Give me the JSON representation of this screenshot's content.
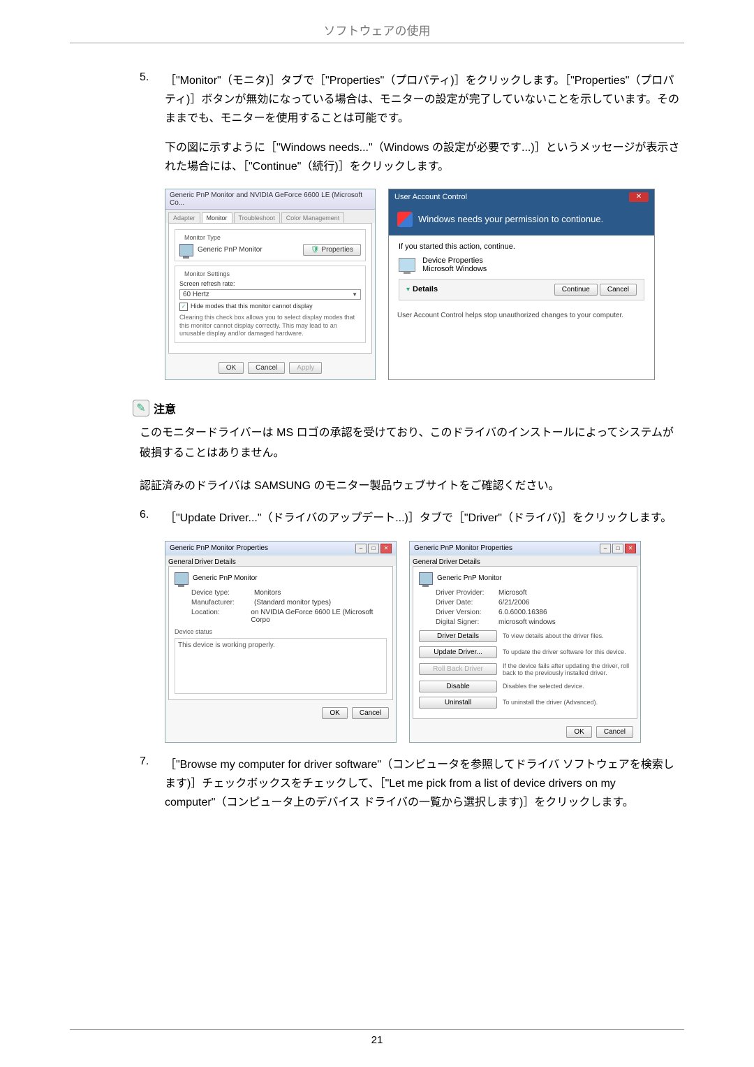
{
  "page": {
    "header_title": "ソフトウェアの使用",
    "footer_page": "21"
  },
  "step5": {
    "num": "5.",
    "body_html": "［\"Monitor\"（モニタ)］タブで［\"Properties\"（プロパティ)］をクリックします。［\"Properties\"（プロパティ)］ボタンが無効になっている場合は、モニターの設定が完了していないことを示しています。そのままでも、モニターを使用することは可能です。",
    "para2": "下の図に示すように［\"Windows needs...\"（Windows の設定が必要です...)］というメッセージが表示された場合には、［\"Continue\"（続行)］をクリックします。"
  },
  "fig1_left": {
    "title": "Generic PnP Monitor and NVIDIA GeForce 6600 LE (Microsoft Co...",
    "tabs": {
      "adapter": "Adapter",
      "monitor": "Monitor",
      "troubleshoot": "Troubleshoot",
      "color": "Color Management"
    },
    "monitor_type_label": "Monitor Type",
    "monitor_type_value": "Generic PnP Monitor",
    "properties_btn": "Properties",
    "monitor_settings_label": "Monitor Settings",
    "refresh_label": "Screen refresh rate:",
    "refresh_value": "60 Hertz",
    "hide_modes": "Hide modes that this monitor cannot display",
    "hide_modes_desc": "Clearing this check box allows you to select display modes that this monitor cannot display correctly. This may lead to an unusable display and/or damaged hardware.",
    "ok": "OK",
    "cancel": "Cancel",
    "apply": "Apply"
  },
  "fig1_right": {
    "titlebar": "User Account Control",
    "headline": "Windows needs your permission to contionue.",
    "if_started": "If you started this action, continue.",
    "dev_props": "Device Properties",
    "ms_win": "Microsoft Windows",
    "details": "Details",
    "continue": "Continue",
    "cancel": "Cancel",
    "footer": "User Account Control helps stop unauthorized changes to your computer."
  },
  "note": {
    "label": "注意",
    "p1": "このモニタードライバーは MS ロゴの承認を受けており、このドライバのインストールによってシステムが破損することはありません。",
    "p2": "認証済みのドライバは SAMSUNG のモニター製品ウェブサイトをご確認ください。"
  },
  "step6": {
    "num": "6.",
    "body": "［\"Update Driver...\"（ドライバのアップデート...)］タブで［\"Driver\"（ドライバ)］をクリックします。"
  },
  "fig2_left": {
    "title": "Generic PnP Monitor Properties",
    "tabs": {
      "general": "General",
      "driver": "Driver",
      "details": "Details"
    },
    "hdr": "Generic PnP Monitor",
    "device_type_k": "Device type:",
    "device_type_v": "Monitors",
    "manufacturer_k": "Manufacturer:",
    "manufacturer_v": "(Standard monitor types)",
    "location_k": "Location:",
    "location_v": "on NVIDIA GeForce 6600 LE (Microsoft Corpo",
    "status_label": "Device status",
    "status_text": "This device is working properly.",
    "ok": "OK",
    "cancel": "Cancel"
  },
  "fig2_right": {
    "title": "Generic PnP Monitor Properties",
    "tabs": {
      "general": "General",
      "driver": "Driver",
      "details": "Details"
    },
    "hdr": "Generic PnP Monitor",
    "provider_k": "Driver Provider:",
    "provider_v": "Microsoft",
    "date_k": "Driver Date:",
    "date_v": "6/21/2006",
    "version_k": "Driver Version:",
    "version_v": "6.0.6000.16386",
    "signer_k": "Digital Signer:",
    "signer_v": "microsoft windows",
    "btn_details": "Driver Details",
    "desc_details": "To view details about the driver files.",
    "btn_update": "Update Driver...",
    "desc_update": "To update the driver software for this device.",
    "btn_rollback": "Roll Back Driver",
    "desc_rollback": "If the device fails after updating the driver, roll back to the previously installed driver.",
    "btn_disable": "Disable",
    "desc_disable": "Disables the selected device.",
    "btn_uninstall": "Uninstall",
    "desc_uninstall": "To uninstall the driver (Advanced).",
    "ok": "OK",
    "cancel": "Cancel"
  },
  "step7": {
    "num": "7.",
    "body": "［\"Browse my computer for driver software\"（コンピュータを参照してドライバ ソフトウェアを検索します)］チェックボックスをチェックして、［\"Let me pick from a list of device drivers on my computer\"（コンピュータ上のデバイス ドライバの一覧から選択します)］をクリックします。"
  }
}
